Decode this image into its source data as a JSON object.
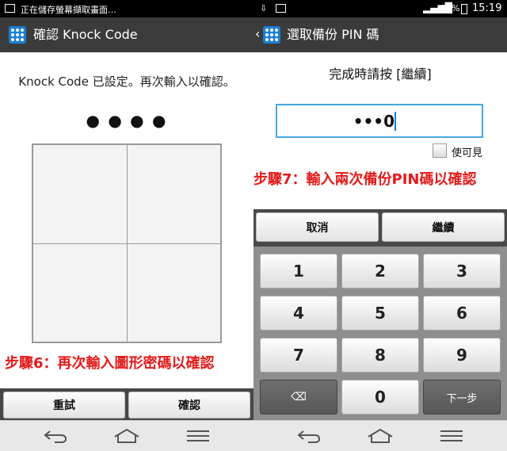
{
  "status": {
    "left_text": "正在儲存螢幕擷取畫面…",
    "battery": "84%",
    "time": "15:19"
  },
  "left": {
    "title": "確認 Knock Code",
    "instruction": "Knock Code 已設定。再次輸入以確認。",
    "dots": "● ● ● ●",
    "annotation": "步驟6：再次輸入圖形密碼以確認",
    "reset_label": "重試",
    "confirm_label": "確認"
  },
  "right": {
    "title": "選取備份 PIN 碼",
    "instruction": "完成時請按 [繼續]",
    "pin_value": "•••0",
    "show_label": "使可見",
    "annotation": "步驟7：輸入兩次備份PIN碼以確認",
    "cancel_label": "取消",
    "continue_label": "繼續",
    "keys": [
      "1",
      "2",
      "3",
      "4",
      "5",
      "6",
      "7",
      "8",
      "9"
    ],
    "zero": "0",
    "backspace": "⌫",
    "next_label": "下一步"
  },
  "icons": {
    "back": "back-icon",
    "home": "home-icon",
    "menu": "menu-icon",
    "accent": "#1b7fd6",
    "annotation_color": "#e31b1b"
  }
}
